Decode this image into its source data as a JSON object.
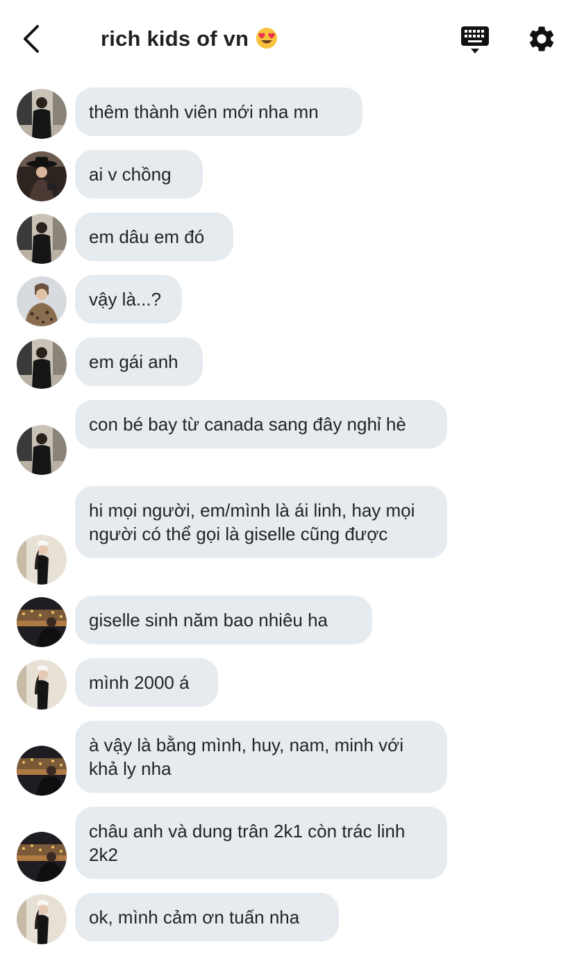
{
  "header": {
    "title": "rich kids of vn",
    "back_icon": "chevron-left-icon",
    "title_emoji": "heart-eyes-emoji",
    "keyboard_icon": "keyboard-icon",
    "settings_icon": "gear-icon"
  },
  "messages": [
    {
      "text": "thêm thành viên mới nha mn"
    },
    {
      "text": "ai v chồng"
    },
    {
      "text": "em dâu em đó"
    },
    {
      "text": "vậy là...?"
    },
    {
      "text": "em gái anh"
    },
    {
      "text": "con bé bay từ canada sang đây nghỉ hè"
    },
    {
      "text": "hi mọi người, em/mình là ái linh, hay mọi người có thể gọi là giselle cũng được"
    },
    {
      "text": "giselle sinh năm bao nhiêu ha"
    },
    {
      "text": "mình 2000 á"
    },
    {
      "text": "à vậy là bằng mình, huy, nam, minh với khả ly nha"
    },
    {
      "text": "châu anh và dung trân 2k1 còn trác linh 2k2"
    },
    {
      "text": "ok, mình cảm ơn tuấn nha"
    }
  ],
  "colors": {
    "bubble": "#e6ebf0",
    "text": "#1f2328",
    "icon": "#111111"
  }
}
